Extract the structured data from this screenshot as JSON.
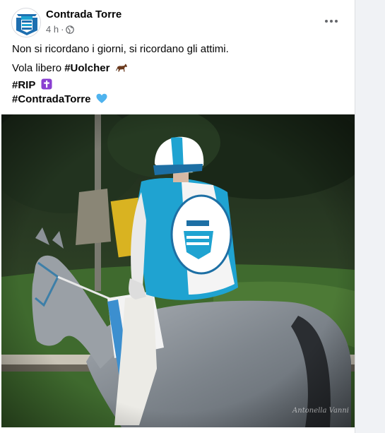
{
  "post": {
    "page_name": "Contrada Torre",
    "time": "4 h",
    "separator": "·",
    "audience_icon": "globe-icon",
    "more_icon": "more-options-icon",
    "avatar_icon": "contrada-torre-emblem"
  },
  "text": {
    "line1": "Non si ricordano i giorni, si ricordano gli attimi.",
    "line2_prefix": "Vola libero ",
    "line2_hashtag": "#Uolcher",
    "line2_emoji": "horse-emoji",
    "line3_hashtag": "#RIP",
    "line3_emoji": "latin-cross-emoji",
    "line4_hashtag": "#ContradaTorre",
    "line4_emoji": "blue-heart-emoji"
  },
  "photo": {
    "subject": "jockey-on-grey-horse",
    "watermark": "Antonella Vanni"
  },
  "colors": {
    "accent_blue": "#1fa3d1",
    "text_secondary": "#65676b",
    "heart_blue": "#4fb3ee",
    "cross_purple": "#8a3fd1"
  }
}
